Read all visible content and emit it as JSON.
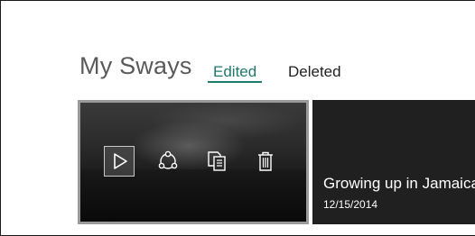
{
  "header": {
    "title": "My Sways",
    "tabs": [
      {
        "label": "Edited",
        "active": true
      },
      {
        "label": "Deleted",
        "active": false
      }
    ]
  },
  "cards": [
    {
      "selected": true,
      "actions": [
        {
          "icon": "play-icon",
          "label": "Play"
        },
        {
          "icon": "share-icon",
          "label": "Share"
        },
        {
          "icon": "duplicate-icon",
          "label": "Duplicate"
        },
        {
          "icon": "delete-icon",
          "label": "Delete"
        }
      ]
    },
    {
      "title": "Growing up in Jamaica",
      "date": "12/15/2014"
    }
  ],
  "colors": {
    "accent": "#1f7a6b",
    "title_text": "#5a5a5a",
    "card_border": "#9a9a9a"
  }
}
